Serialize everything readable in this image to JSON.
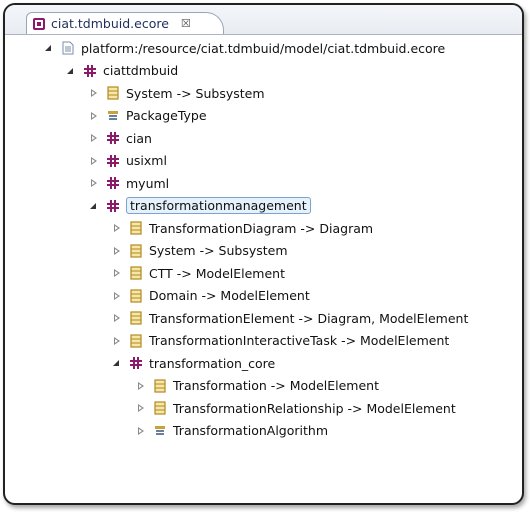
{
  "editor": {
    "tab_title": "ciat.tdmbuid.ecore",
    "close_glyph": "☒"
  },
  "tree": {
    "root": {
      "label": "platform:/resource/ciat.tdmbuid/model/ciat.tdmbuid.ecore",
      "icon": "resource-file-icon",
      "state": "expanded"
    },
    "package": {
      "label": "ciattdmbuid",
      "icon": "package-icon",
      "state": "expanded"
    },
    "items": [
      {
        "label": "System -> Subsystem",
        "icon": "class-icon",
        "state": "collapsed"
      },
      {
        "label": "PackageType",
        "icon": "enum-icon",
        "state": "collapsed"
      },
      {
        "label": "cian",
        "icon": "package-icon",
        "state": "collapsed"
      },
      {
        "label": "usixml",
        "icon": "package-icon",
        "state": "collapsed"
      },
      {
        "label": "myuml",
        "icon": "package-icon",
        "state": "collapsed"
      },
      {
        "label": "transformationmanagement",
        "icon": "package-icon",
        "state": "expanded",
        "selected": true
      }
    ],
    "tm_items": [
      {
        "label": "TransformationDiagram -> Diagram",
        "icon": "class-icon",
        "state": "collapsed"
      },
      {
        "label": "System -> Subsystem",
        "icon": "class-icon",
        "state": "collapsed"
      },
      {
        "label": "CTT -> ModelElement",
        "icon": "class-icon",
        "state": "collapsed"
      },
      {
        "label": "Domain -> ModelElement",
        "icon": "class-icon",
        "state": "collapsed"
      },
      {
        "label": "TransformationElement -> Diagram, ModelElement",
        "icon": "class-icon",
        "state": "collapsed"
      },
      {
        "label": "TransformationInteractiveTask -> ModelElement",
        "icon": "class-icon",
        "state": "collapsed"
      },
      {
        "label": "transformation_core",
        "icon": "package-icon",
        "state": "expanded"
      }
    ],
    "core_items": [
      {
        "label": "Transformation -> ModelElement",
        "icon": "class-icon",
        "state": "collapsed"
      },
      {
        "label": "TransformationRelationship -> ModelElement",
        "icon": "class-icon",
        "state": "collapsed"
      },
      {
        "label": "TransformationAlgorithm",
        "icon": "enum-icon",
        "state": "collapsed"
      }
    ]
  },
  "colors": {
    "package_icon": "#8b1a6b",
    "class_icon_fill": "#f6e7a8",
    "class_icon_border": "#b08a1e",
    "selection_bg": "#e5f1fb",
    "selection_border": "#7da2ce"
  }
}
